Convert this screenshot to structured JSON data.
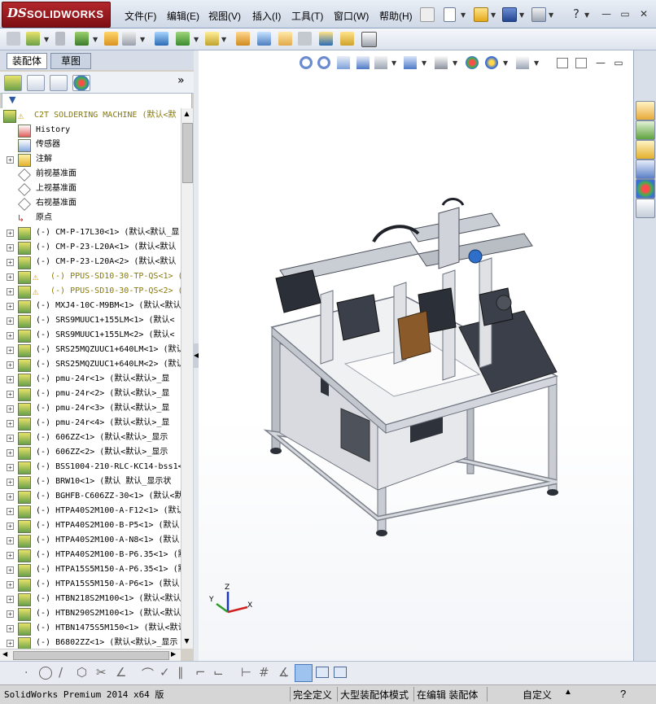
{
  "app": {
    "logo_ds": "DS",
    "logo_text": "SOLIDWORKS"
  },
  "menu": [
    "文件(F)",
    "编辑(E)",
    "视图(V)",
    "插入(I)",
    "工具(T)",
    "窗口(W)",
    "帮助(H)"
  ],
  "window_controls": {
    "help": "?",
    "minimize": "—",
    "restore": "▭",
    "close": "✕"
  },
  "command_tabs": [
    "装配体",
    "草图"
  ],
  "feature_manager": {
    "expand_label": "»",
    "root": "C2T SOLDERING MACHINE  (默认<默",
    "items": [
      {
        "label": "History",
        "icon": "history-icon",
        "expand": false
      },
      {
        "label": "传感器",
        "icon": "sensor-icon",
        "expand": false
      },
      {
        "label": "注解",
        "icon": "annotation-icon",
        "expand": true
      },
      {
        "label": "前视基准面",
        "icon": "plane-icon",
        "expand": false
      },
      {
        "label": "上视基准面",
        "icon": "plane-icon",
        "expand": false
      },
      {
        "label": "右视基准面",
        "icon": "plane-icon",
        "expand": false
      },
      {
        "label": "原点",
        "icon": "origin-icon",
        "expand": false
      },
      {
        "label": "(-) CM-P-17L30<1> (默认<默认_显",
        "icon": "part-icon",
        "expand": true
      },
      {
        "label": "(-) CM-P-23-L20A<1> (默认<默认",
        "icon": "part-icon",
        "expand": true
      },
      {
        "label": "(-) CM-P-23-L20A<2> (默认<默认",
        "icon": "part-icon",
        "expand": true
      },
      {
        "label": "(-) PPUS-SD10-30-TP-QS<1> (",
        "icon": "warn-part-icon",
        "expand": true,
        "warn": true
      },
      {
        "label": "(-) PPUS-SD10-30-TP-QS<2> (",
        "icon": "warn-part-icon",
        "expand": true,
        "warn": true
      },
      {
        "label": "(-) MXJ4-10C-M9BM<1> (默认<默认",
        "icon": "part-icon",
        "expand": true
      },
      {
        "label": "(-) SRS9MUUC1+155LM<1> (默认<",
        "icon": "part-icon",
        "expand": true
      },
      {
        "label": "(-) SRS9MUUC1+155LM<2> (默认<",
        "icon": "part-icon",
        "expand": true
      },
      {
        "label": "(-) SRS25MQZUUC1+640LM<1> (默认",
        "icon": "part-icon",
        "expand": true
      },
      {
        "label": "(-) SRS25MQZUUC1+640LM<2> (默认",
        "icon": "part-icon",
        "expand": true
      },
      {
        "label": "(-) pmu-24r<1> (默认<默认>_显",
        "icon": "part-icon",
        "expand": true
      },
      {
        "label": "(-) pmu-24r<2> (默认<默认>_显",
        "icon": "part-icon",
        "expand": true
      },
      {
        "label": "(-) pmu-24r<3> (默认<默认>_显",
        "icon": "part-icon",
        "expand": true
      },
      {
        "label": "(-) pmu-24r<4> (默认<默认>_显",
        "icon": "part-icon",
        "expand": true
      },
      {
        "label": "(-) 606ZZ<1> (默认<默认>_显示",
        "icon": "part-icon",
        "expand": true
      },
      {
        "label": "(-) 606ZZ<2> (默认<默认>_显示",
        "icon": "part-icon",
        "expand": true
      },
      {
        "label": "(-) BSS1004-210-RLC-KC14-bss1<",
        "icon": "part-icon",
        "expand": true
      },
      {
        "label": "(-) BRW10<1> (默认 默认_显示状",
        "icon": "part-icon",
        "expand": true
      },
      {
        "label": "(-) BGHFB-C606ZZ-30<1> (默认<默",
        "icon": "part-icon",
        "expand": true
      },
      {
        "label": "(-) HTPA40S2M100-A-F12<1> (默认",
        "icon": "part-icon",
        "expand": true
      },
      {
        "label": "(-) HTPA40S2M100-B-P5<1> (默认",
        "icon": "part-icon",
        "expand": true
      },
      {
        "label": "(-) HTPA40S2M100-A-N8<1> (默认",
        "icon": "part-icon",
        "expand": true
      },
      {
        "label": "(-) HTPA40S2M100-B-P6.35<1> (默",
        "icon": "part-icon",
        "expand": true
      },
      {
        "label": "(-) HTPA15S5M150-A-P6.35<1> (默",
        "icon": "part-icon",
        "expand": true
      },
      {
        "label": "(-) HTPA15S5M150-A-P6<1> (默认",
        "icon": "part-icon",
        "expand": true
      },
      {
        "label": "(-) HTBN218S2M100<1> (默认<默认",
        "icon": "part-icon",
        "expand": true
      },
      {
        "label": "(-) HTBN290S2M100<1> (默认<默认",
        "icon": "part-icon",
        "expand": true
      },
      {
        "label": "(-) HTBN1475S5M150<1> (默认<默认",
        "icon": "part-icon",
        "expand": true
      },
      {
        "label": "(-) B6802ZZ<1> (默认<默认>_显示",
        "icon": "part-icon",
        "expand": true
      }
    ]
  },
  "triad": {
    "x": "X",
    "y": "Y",
    "z": "Z"
  },
  "status": {
    "version": "SolidWorks Premium 2014 x64 版",
    "defined": "完全定义",
    "mode": "大型装配体模式",
    "editing": "在编辑 装配体",
    "units": "自定义",
    "help": "?"
  },
  "colors": {
    "accent": "#b3262b",
    "tree_warn": "#8a7a00",
    "machine_frame": "#c9ccd2",
    "machine_dark": "#2b2f38"
  }
}
